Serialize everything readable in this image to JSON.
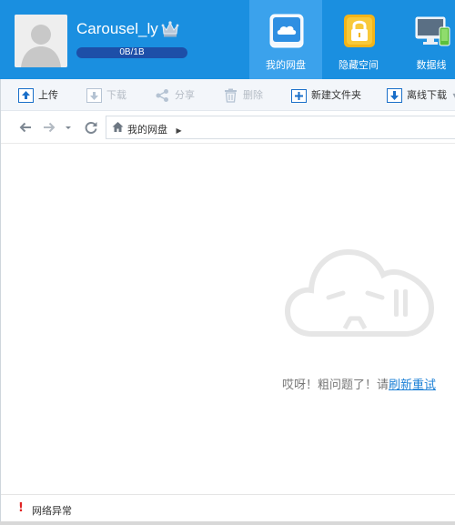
{
  "user": {
    "name": "Carousel_ly",
    "quota_text": "0B/1B",
    "quota_used_fraction": 0.0,
    "avatar_icon": "default-user-avatar",
    "badge_icon": "crown-icon"
  },
  "nav": {
    "tabs": [
      {
        "label": "我的网盘",
        "icon": "cloud-drive-icon",
        "active": true
      },
      {
        "label": "隐藏空间",
        "icon": "lock-icon",
        "active": false
      },
      {
        "label": "数据线",
        "icon": "monitor-phone-icon",
        "active": false
      }
    ]
  },
  "toolbar": {
    "upload": "上传",
    "download": "下载",
    "share": "分享",
    "delete": "删除",
    "new_folder": "新建文件夹",
    "offline_download": "离线下载"
  },
  "addressbar": {
    "path": "我的网盘"
  },
  "content": {
    "error_text": "哎呀！粗问题了！请",
    "retry_link": "刷新重试"
  },
  "status": {
    "text": "网络异常"
  },
  "colors": {
    "header_bg": "#1a8fe0",
    "active_tab_bg": "#3ba2ec",
    "link": "#1a7fd6",
    "error": "#e02424"
  }
}
